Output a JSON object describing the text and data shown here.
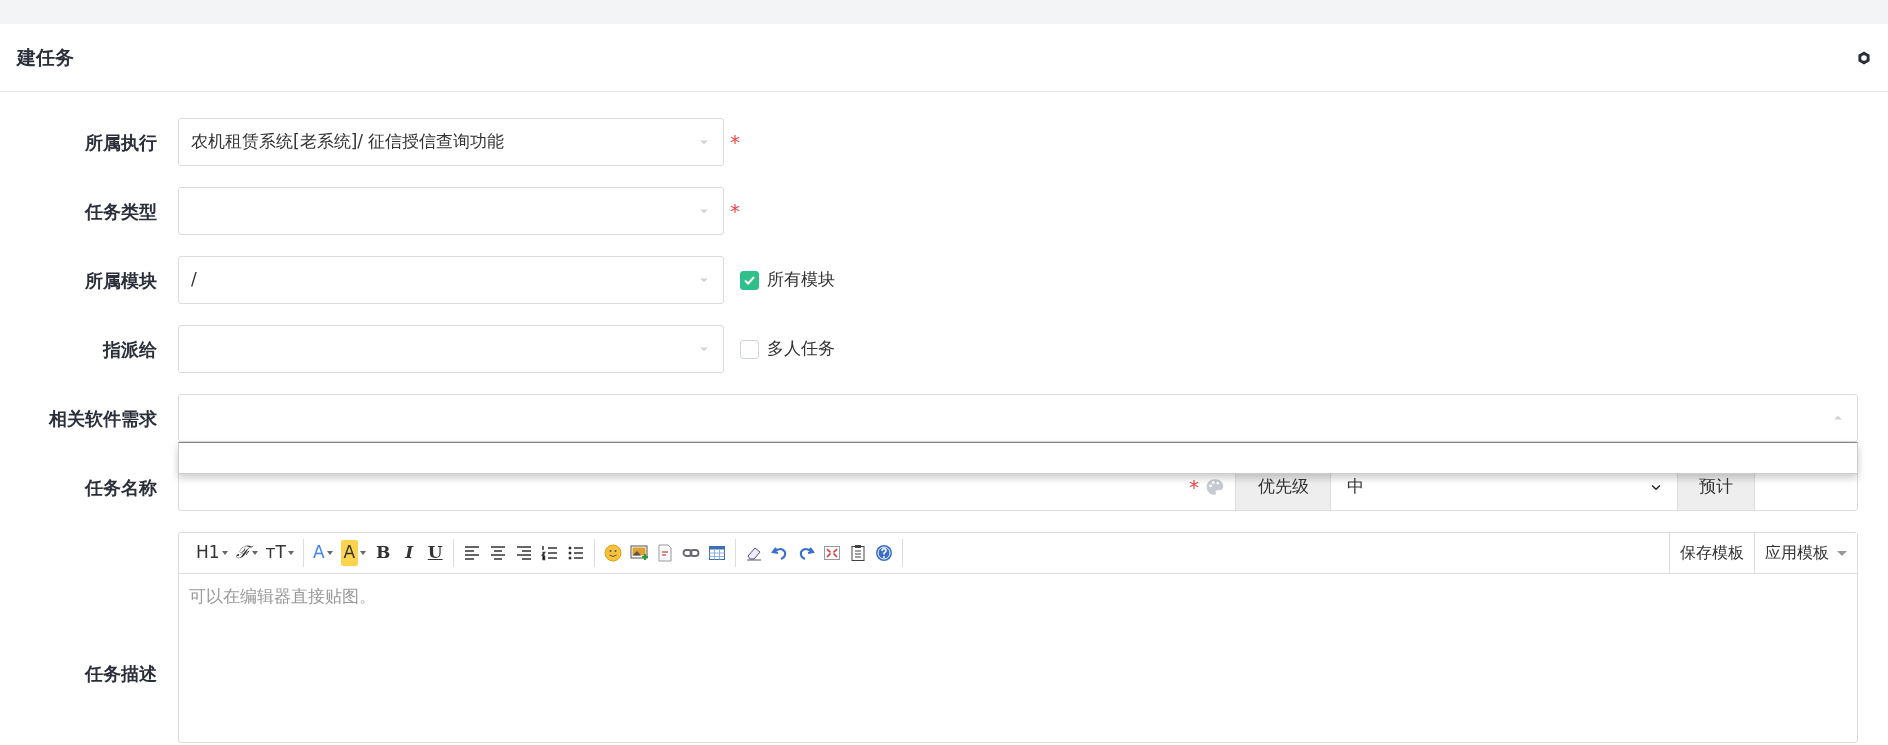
{
  "page_title": "建任务",
  "fields": [
    {
      "label": "所属执行",
      "kind": "select",
      "value": "农机租赁系统[老系统]/ 征信授信查询功能",
      "required_mark": "*"
    },
    {
      "label": "任务类型",
      "kind": "select",
      "required_mark": "*"
    },
    {
      "label": "所属模块",
      "kind": "select",
      "value": "/",
      "option": {
        "label": "所有模块",
        "checked": true
      }
    },
    {
      "label": "指派给",
      "kind": "select",
      "option": {
        "label": "多人任务",
        "checked": false
      }
    },
    {
      "label": "相关软件需求",
      "kind": "wide-select",
      "expanded": true
    },
    {
      "label": "任务名称",
      "kind": "name",
      "required_mark": "*",
      "priority": {
        "label": "优先级",
        "value": "中"
      },
      "estimate": {
        "label": "预计"
      }
    },
    {
      "label": "任务描述",
      "kind": "editor",
      "placeholder": "可以在编辑器直接贴图。"
    }
  ],
  "editor_toolbar": [
    [
      {
        "kind": "heading",
        "label": "H1"
      },
      {
        "kind": "font",
        "label": "ℱ"
      },
      {
        "kind": "size",
        "label": "ᴛT"
      }
    ],
    [
      {
        "kind": "font-color",
        "label": "A"
      },
      {
        "kind": "highlight",
        "label": "A"
      },
      {
        "kind": "bold",
        "label": "B"
      },
      {
        "kind": "italic",
        "label": "I"
      },
      {
        "kind": "underline",
        "label": "U"
      }
    ],
    [
      {
        "kind": "align-left"
      },
      {
        "kind": "align-center"
      },
      {
        "kind": "align-right"
      },
      {
        "kind": "ordered-list"
      },
      {
        "kind": "bullet-list"
      }
    ],
    [
      {
        "kind": "emoji"
      },
      {
        "kind": "image"
      },
      {
        "kind": "code"
      },
      {
        "kind": "link"
      },
      {
        "kind": "table"
      }
    ],
    [
      {
        "kind": "eraser"
      },
      {
        "kind": "undo"
      },
      {
        "kind": "redo"
      },
      {
        "kind": "fullscreen"
      },
      {
        "kind": "paste"
      },
      {
        "kind": "help"
      }
    ]
  ],
  "template_buttons": [
    {
      "label": "保存模板",
      "caret": false
    },
    {
      "label": "应用模板",
      "caret": true
    }
  ]
}
